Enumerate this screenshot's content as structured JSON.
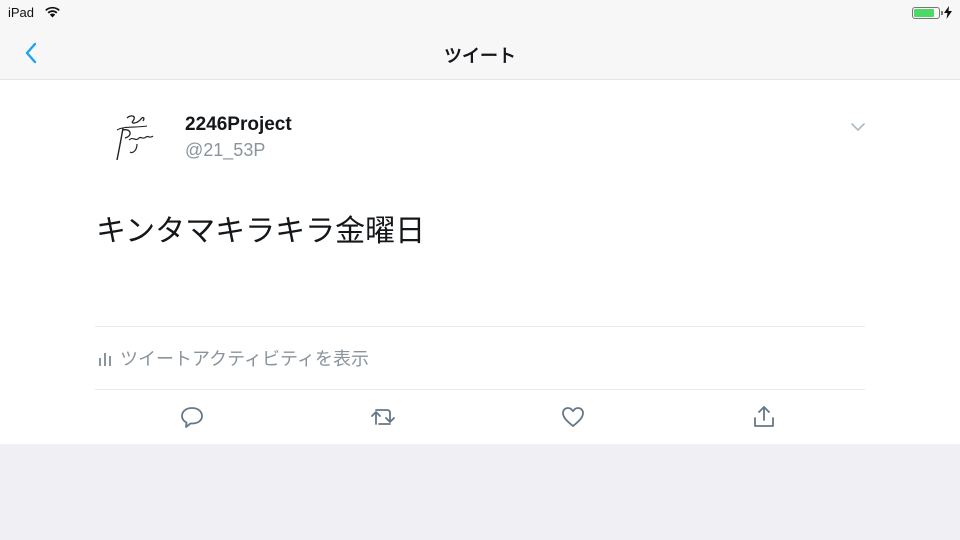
{
  "status_bar": {
    "device": "iPad",
    "wifi_icon": "wifi-icon",
    "battery_icon": "battery-icon",
    "battery_level": 0.85,
    "battery_color": "#4cd964"
  },
  "nav": {
    "title": "ツイート",
    "back_icon": "chevron-left-icon",
    "accent": "#1da1f2"
  },
  "tweet": {
    "display_name": "2246Project",
    "handle": "@21_53P",
    "text": "キンタマキラキラ金曜日",
    "menu_icon": "chevron-down-icon",
    "activity_label": "ツイートアクティビティを表示",
    "activity_icon": "bar-chart-icon",
    "actions": [
      {
        "name": "reply",
        "icon": "reply-icon"
      },
      {
        "name": "retweet",
        "icon": "retweet-icon"
      },
      {
        "name": "like",
        "icon": "heart-icon"
      },
      {
        "name": "share",
        "icon": "share-icon"
      }
    ]
  }
}
